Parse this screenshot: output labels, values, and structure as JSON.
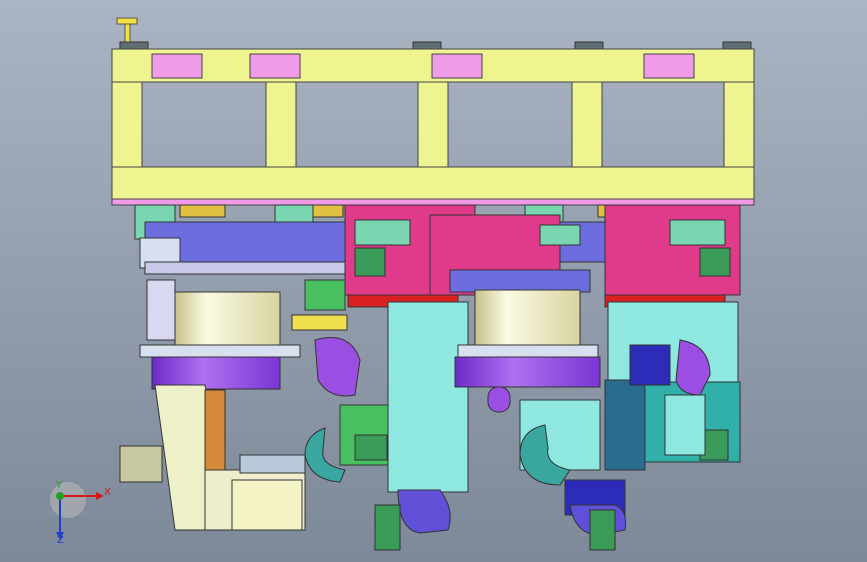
{
  "view": {
    "background_top": "#aab4c2",
    "background_bottom": "#7d8898"
  },
  "triad": {
    "x_label": "X",
    "y_label": "Y",
    "z_label": "Z",
    "x_color": "#d21a1a",
    "y_color": "#22a022",
    "z_color": "#2040c8"
  },
  "palette": {
    "frame": "#eef590",
    "frame_pad": "#f09be8",
    "cap": "#5e6e74",
    "magenta": "#e03a8a",
    "cyan": "#8ee8e0",
    "purple": "#9a4ee2",
    "blue": "#6c6ee0",
    "mint": "#a8e8c8",
    "green": "#48c060",
    "cream": "#f4f3c6",
    "tan": "#efe6b0",
    "orange": "#d7893a",
    "navy": "#2c2cb8",
    "red": "#d82020",
    "teal": "#30b0a8"
  }
}
